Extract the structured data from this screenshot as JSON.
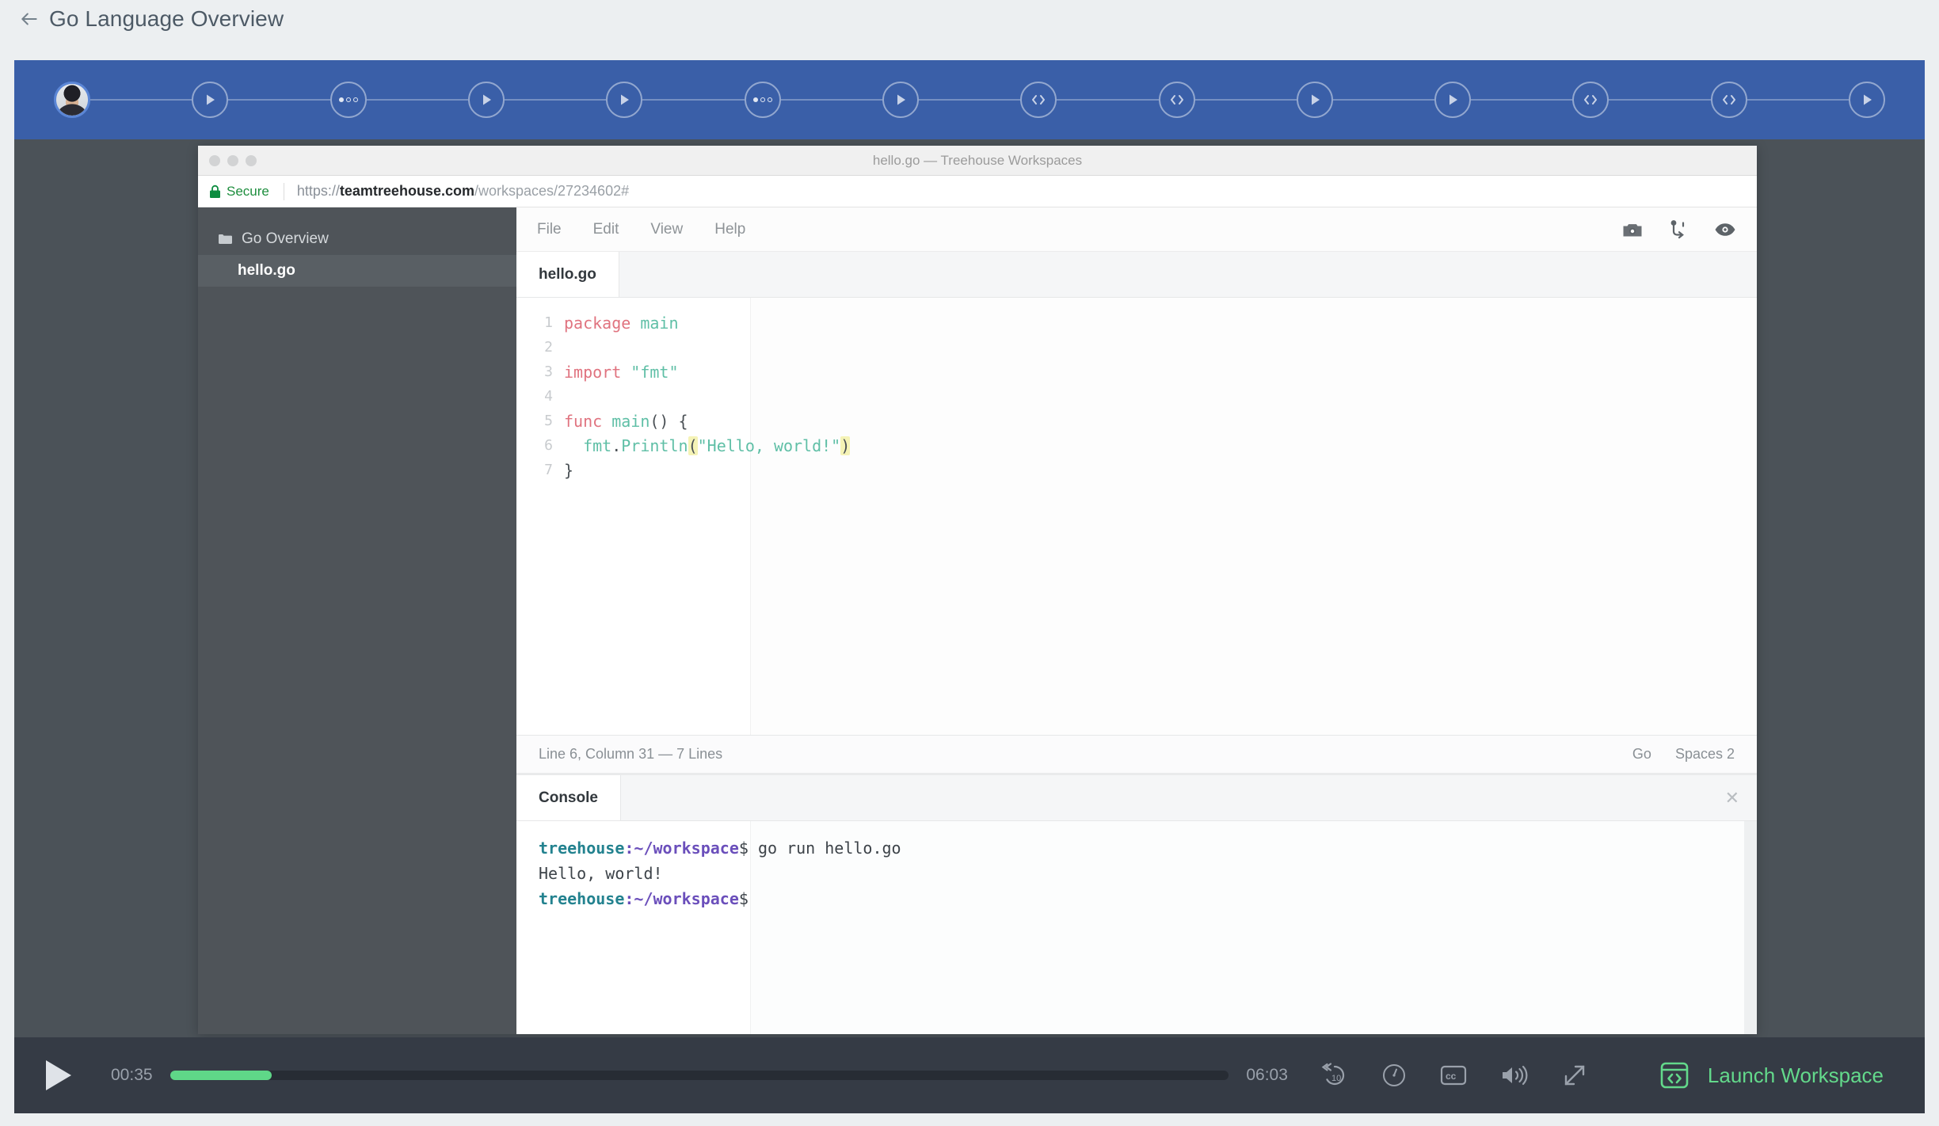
{
  "header": {
    "back_icon": "arrow-left-icon",
    "title": "Go Language Overview"
  },
  "colors": {
    "stepper_bg": "#3a5fa8",
    "stage_bg": "#4b5258",
    "controls_bg": "#353b45",
    "progress_green": "#5fd788",
    "launch_green": "#63d98b",
    "secure_green": "#1e8e3e",
    "page_bg": "#eceff1"
  },
  "stepper": {
    "steps": [
      {
        "icon": "avatar",
        "label": "instructor-avatar",
        "active": true
      },
      {
        "icon": "play",
        "label": "video-step"
      },
      {
        "icon": "quiz",
        "label": "quiz-step"
      },
      {
        "icon": "play",
        "label": "video-step"
      },
      {
        "icon": "play",
        "label": "video-step"
      },
      {
        "icon": "quiz",
        "label": "quiz-step"
      },
      {
        "icon": "play",
        "label": "video-step"
      },
      {
        "icon": "code",
        "label": "code-challenge-step"
      },
      {
        "icon": "code",
        "label": "code-challenge-step"
      },
      {
        "icon": "play",
        "label": "video-step"
      },
      {
        "icon": "play",
        "label": "video-step"
      },
      {
        "icon": "code",
        "label": "code-challenge-step"
      },
      {
        "icon": "code",
        "label": "code-challenge-step"
      },
      {
        "icon": "play",
        "label": "video-step"
      }
    ]
  },
  "browser": {
    "window_title": "hello.go — Treehouse Workspaces",
    "traffic_lights": [
      "close",
      "minimize",
      "maximize"
    ],
    "urlbar": {
      "lock_icon": "lock-icon",
      "secure_label": "Secure",
      "url_scheme": "https://",
      "url_domain": "teamtreehouse.com",
      "url_path": "/workspaces/27234602#"
    }
  },
  "workspace": {
    "sidebar": {
      "folder": {
        "icon": "folder-icon",
        "name": "Go Overview"
      },
      "files": [
        {
          "name": "hello.go",
          "selected": true
        }
      ]
    },
    "menubar": {
      "items": [
        "File",
        "Edit",
        "View",
        "Help"
      ],
      "icons": [
        "camera-icon",
        "git-branch-icon",
        "eye-icon"
      ]
    },
    "editor": {
      "tabs": [
        {
          "label": "hello.go",
          "active": true
        }
      ],
      "language": "Go",
      "lines": [
        {
          "n": "1",
          "segments": [
            {
              "t": "package ",
              "c": "kw"
            },
            {
              "t": "main",
              "c": "fn"
            }
          ]
        },
        {
          "n": "2",
          "segments": []
        },
        {
          "n": "3",
          "segments": [
            {
              "t": "import ",
              "c": "kw"
            },
            {
              "t": "\"fmt\"",
              "c": "str"
            }
          ]
        },
        {
          "n": "4",
          "segments": []
        },
        {
          "n": "5",
          "segments": [
            {
              "t": "func ",
              "c": "kw"
            },
            {
              "t": "main",
              "c": "fn"
            },
            {
              "t": "() {",
              "c": "plain"
            }
          ]
        },
        {
          "n": "6",
          "segments": [
            {
              "t": "  fmt",
              "c": "fn"
            },
            {
              "t": ".",
              "c": "plain"
            },
            {
              "t": "Println",
              "c": "fn"
            },
            {
              "t": "(",
              "c": "plain",
              "hl": true
            },
            {
              "t": "\"Hello, world!\"",
              "c": "str"
            },
            {
              "t": ")",
              "c": "plain",
              "hl": true
            }
          ]
        },
        {
          "n": "7",
          "segments": [
            {
              "t": "}",
              "c": "plain"
            }
          ]
        }
      ],
      "status": {
        "position": "Line 6, Column 31 — 7 Lines",
        "language": "Go",
        "indent": "Spaces  2"
      }
    },
    "console": {
      "tab_label": "Console",
      "close_icon": "close-icon",
      "lines": [
        {
          "host": "treehouse",
          "path": ":~/workspace",
          "prompt": "$ ",
          "command": "go run hello.go"
        },
        {
          "output": "Hello, world!"
        },
        {
          "host": "treehouse",
          "path": ":~/workspace",
          "prompt": "$",
          "command": ""
        }
      ]
    }
  },
  "player": {
    "play_icon": "play-icon",
    "time_current": "00:35",
    "time_total": "06:03",
    "progress_percent": 9.6,
    "controls": [
      {
        "icon": "rewind-10-icon",
        "label": "Rewind 10 seconds"
      },
      {
        "icon": "playback-speed-icon",
        "label": "Playback speed"
      },
      {
        "icon": "closed-captions-icon",
        "label": "CC"
      },
      {
        "icon": "volume-icon",
        "label": "Volume"
      },
      {
        "icon": "fullscreen-icon",
        "label": "Fullscreen"
      }
    ],
    "launch_workspace": {
      "icon": "code-window-icon",
      "label": "Launch Workspace"
    }
  }
}
